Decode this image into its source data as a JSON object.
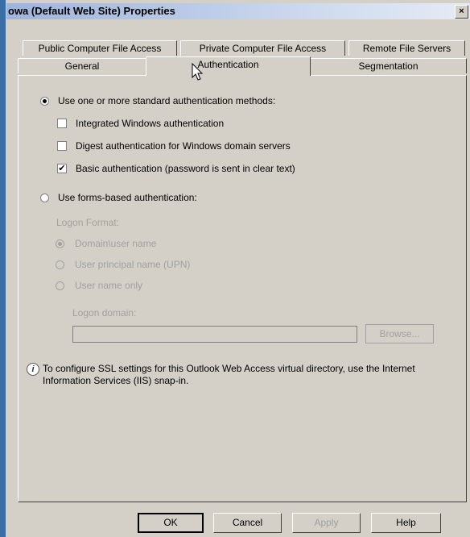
{
  "window": {
    "title": "owa (Default Web Site) Properties",
    "close_glyph": "×"
  },
  "tabs_row1": [
    {
      "label": "Public Computer File Access"
    },
    {
      "label": "Private Computer File Access"
    },
    {
      "label": "Remote File Servers"
    }
  ],
  "tabs_row2": [
    {
      "label": "General"
    },
    {
      "label": "Authentication",
      "active": true
    },
    {
      "label": "Segmentation"
    }
  ],
  "auth": {
    "standard_radio": "Use one or more standard authentication methods:",
    "standard_selected": true,
    "integrated": {
      "label": "Integrated Windows authentication",
      "checked": false
    },
    "digest": {
      "label": "Digest authentication for Windows domain servers",
      "checked": false
    },
    "basic": {
      "label": "Basic authentication (password is sent in clear text)",
      "checked": true
    },
    "forms_radio": "Use forms-based authentication:",
    "forms_selected": false,
    "logon_format_label": "Logon Format:",
    "format_options": [
      {
        "label": "Domain\\user name",
        "selected": true
      },
      {
        "label": "User principal name (UPN)",
        "selected": false
      },
      {
        "label": "User name only",
        "selected": false
      }
    ],
    "logon_domain_label": "Logon domain:",
    "logon_domain_value": "",
    "browse_label": "Browse..."
  },
  "info": {
    "icon": "info-icon",
    "text": "To configure SSL settings for this Outlook Web Access virtual directory, use the Internet Information Services (IIS) snap-in."
  },
  "buttons": {
    "ok": "OK",
    "cancel": "Cancel",
    "apply": "Apply",
    "help": "Help"
  },
  "colors": {
    "face": "#d4d0c8",
    "title_gradient_start": "#9db4dc",
    "disabled_text": "#a0a0a0"
  }
}
